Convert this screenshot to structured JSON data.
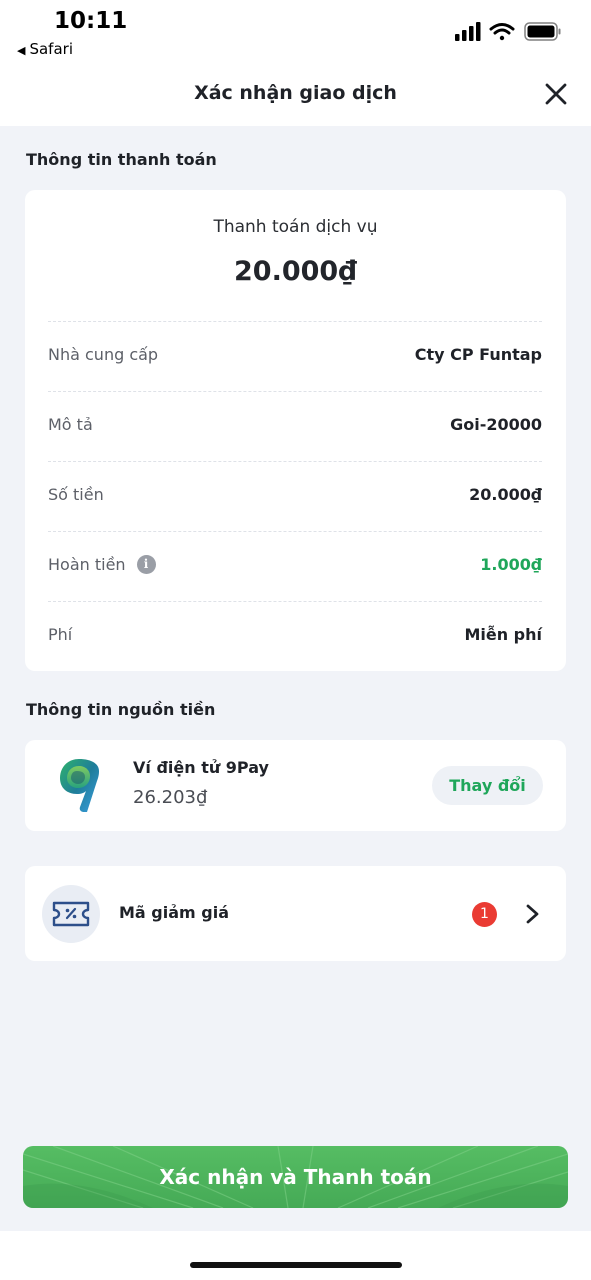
{
  "status_bar": {
    "time": "10:11",
    "back_app": "Safari"
  },
  "header": {
    "title": "Xác nhận giao dịch"
  },
  "payment_info": {
    "section_title": "Thông tin thanh toán",
    "subtitle": "Thanh toán dịch vụ",
    "amount": "20.000₫",
    "rows": [
      {
        "label": "Nhà cung cấp",
        "value": "Cty CP Funtap"
      },
      {
        "label": "Mô tả",
        "value": "Goi-20000"
      },
      {
        "label": "Số tiền",
        "value": "20.000₫"
      },
      {
        "label": "Hoàn tiền",
        "value": "1.000₫"
      },
      {
        "label": "Phí",
        "value": "Miễn phí"
      }
    ]
  },
  "funding_source": {
    "section_title": "Thông tin nguồn tiền",
    "wallet_name": "Ví điện tử 9Pay",
    "balance": "26.203₫",
    "change_label": "Thay đổi"
  },
  "voucher": {
    "label": "Mã giảm giá",
    "count": "1"
  },
  "confirm_button": {
    "label": "Xác nhận và Thanh toán"
  },
  "colors": {
    "accent_green": "#1fa65a",
    "button_green": "#4cb35d",
    "badge_red": "#ea3b33",
    "background": "#f1f3f8"
  },
  "icons": [
    "back-arrow-icon",
    "signal-icon",
    "wifi-icon",
    "battery-icon",
    "close-icon",
    "info-icon",
    "9pay-logo",
    "discount-ticket-icon",
    "chevron-right-icon"
  ]
}
